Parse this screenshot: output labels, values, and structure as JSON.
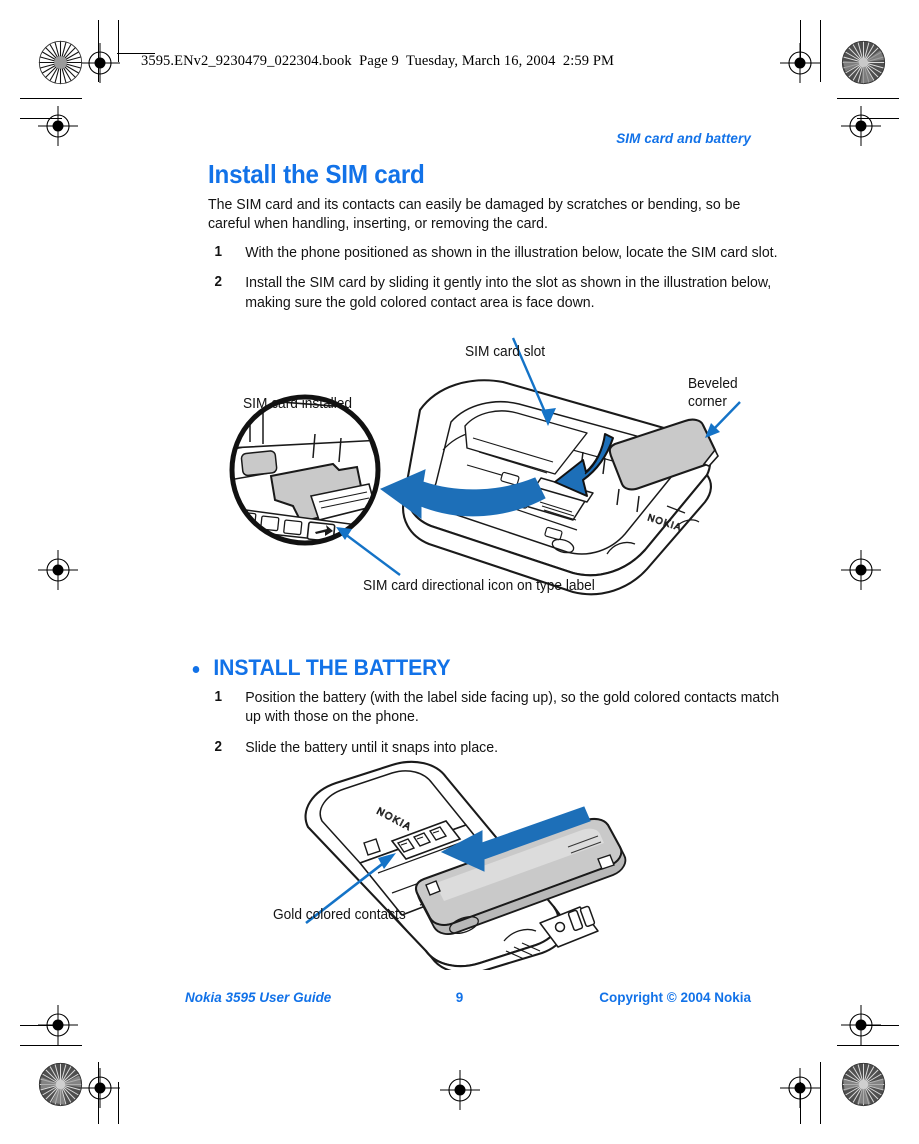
{
  "page": {
    "bookfile_line": "3595.ENv2_9230479_022304.book  Page 9  Tuesday, March 16, 2004  2:59 PM",
    "running_header": "SIM card and battery",
    "accent_blue": "#1272E8",
    "body_black": "#131313",
    "paper": "#FFFFFF"
  },
  "section_sim": {
    "title": "Install the SIM card",
    "intro": "The SIM card and its contacts can easily be damaged by scratches or bending, so be careful when handling, inserting, or removing the card.",
    "steps": [
      {
        "num": "1",
        "text": "With the phone positioned as shown in the illustration below, locate the SIM card slot."
      },
      {
        "num": "2",
        "text": "Install the SIM card by sliding it gently into the slot as shown in the illustration below, making sure the gold colored contact area is face down."
      }
    ],
    "figure": {
      "name": "sim-card-installation-illustration",
      "labels": [
        {
          "id": "sim-card-slot",
          "text": "SIM card slot"
        },
        {
          "id": "sim-card-installed",
          "text": "SIM card installed"
        },
        {
          "id": "beveled-corner",
          "text": "Beveled\ncorner"
        },
        {
          "id": "sim-directional-icon",
          "text": "SIM card directional icon on type label"
        }
      ],
      "phone_brand_mark": "NOKIA"
    }
  },
  "section_battery": {
    "title": "INSTALL THE BATTERY",
    "bullet": "•",
    "steps": [
      {
        "num": "1",
        "text": "Position the battery (with the label side facing up), so the gold colored contacts match up with those on the phone."
      },
      {
        "num": "2",
        "text": "Slide the battery until it snaps into place."
      }
    ],
    "figure": {
      "name": "battery-installation-illustration",
      "labels": [
        {
          "id": "gold-colored-contacts",
          "text": "Gold colored contacts"
        }
      ],
      "phone_brand_mark": "NOKIA"
    }
  },
  "footer": {
    "left": "Nokia 3595 User Guide",
    "page_number": "9",
    "right": "Copyright © 2004 Nokia"
  }
}
